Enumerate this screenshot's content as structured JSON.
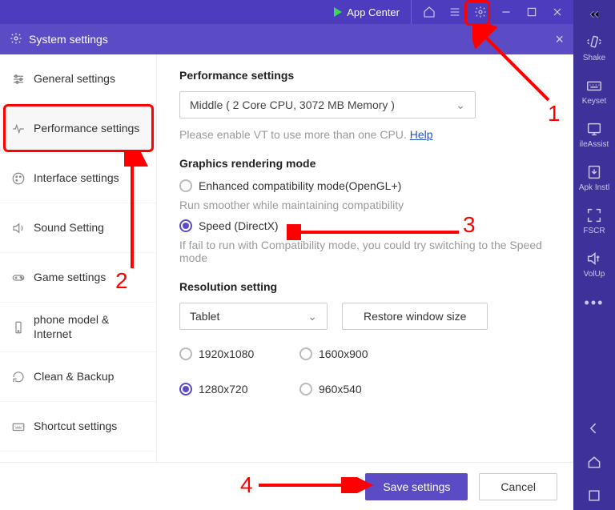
{
  "topbar": {
    "app_center": "App Center"
  },
  "modal": {
    "title": "System settings"
  },
  "sidebar": {
    "general": "General settings",
    "performance": "Performance settings",
    "interface": "Interface settings",
    "sound": "Sound Setting",
    "game": "Game settings",
    "phone": "phone model & Internet",
    "clean": "Clean & Backup",
    "shortcut": "Shortcut settings"
  },
  "panel": {
    "perf_title": "Performance settings",
    "perf_select": "Middle ( 2 Core CPU, 3072 MB Memory )",
    "perf_hint_pre": "Please enable VT to use more than one CPU. ",
    "perf_hint_link": "Help",
    "gfx_title": "Graphics rendering mode",
    "opt_enhanced": "Enhanced compatibility mode(OpenGL+)",
    "opt_enhanced_hint": "Run smoother while maintaining compatibility",
    "opt_speed": "Speed (DirectX)",
    "opt_speed_hint": "If fail to run with Compatibility mode, you could try switching to the Speed mode",
    "res_title": "Resolution setting",
    "res_select": "Tablet",
    "restore_btn": "Restore window size",
    "res_1": "1920x1080",
    "res_2": "1600x900",
    "res_3": "1280x720",
    "res_4": "960x540"
  },
  "footer": {
    "save": "Save settings",
    "cancel": "Cancel"
  },
  "rail": {
    "shake": "Shake",
    "keyset": "Keyset",
    "ileassist": "ileAssist",
    "apkinstl": "Apk Instl",
    "fscr": "FSCR",
    "volup": "VolUp"
  },
  "annotations": {
    "n1": "1",
    "n2": "2",
    "n3": "3",
    "n4": "4"
  }
}
